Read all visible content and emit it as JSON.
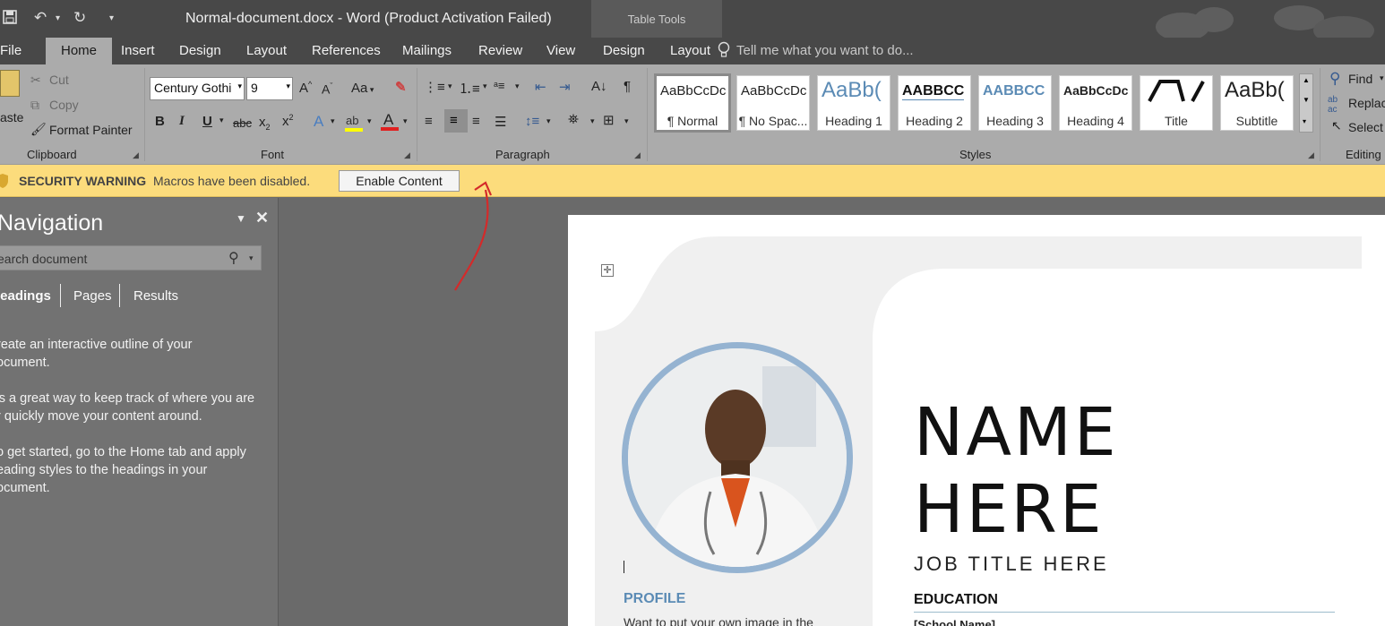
{
  "titlebar": {
    "doc_title": "Normal-document.docx - Word (Product Activation Failed)",
    "table_tools": "Table Tools"
  },
  "tabs": {
    "file": "File",
    "home": "Home",
    "insert": "Insert",
    "design": "Design",
    "layout": "Layout",
    "references": "References",
    "mailings": "Mailings",
    "review": "Review",
    "view": "View",
    "table_design": "Design",
    "table_layout": "Layout",
    "tell_me": "Tell me what you want to do..."
  },
  "clipboard": {
    "paste": "aste",
    "cut": "Cut",
    "copy": "Copy",
    "format_painter": "Format Painter",
    "label": "Clipboard"
  },
  "font": {
    "family": "Century Gothi",
    "size": "9",
    "change_case": "Aa",
    "label": "Font"
  },
  "paragraph": {
    "label": "Paragraph"
  },
  "styles": {
    "label": "Styles",
    "items": [
      {
        "sample": "AaBbCcDc",
        "name": "¶ Normal"
      },
      {
        "sample": "AaBbCcDc",
        "name": "¶ No Spac..."
      },
      {
        "sample": "AaBb(",
        "name": "Heading 1"
      },
      {
        "sample": "AABBCC",
        "name": "Heading 2"
      },
      {
        "sample": "AABBCC",
        "name": "Heading 3"
      },
      {
        "sample": "AaBbCcDc",
        "name": "Heading 4"
      },
      {
        "sample": "/\\ /",
        "name": "Title"
      },
      {
        "sample": "AaBb(",
        "name": "Subtitle"
      }
    ]
  },
  "editing": {
    "find": "Find",
    "replace": "Replac",
    "select": "Select",
    "label": "Editing"
  },
  "security": {
    "warning": "SECURITY WARNING",
    "message": "Macros have been disabled.",
    "enable": "Enable Content"
  },
  "navigation": {
    "title": "Navigation",
    "search_placeholder": "earch document",
    "tabs": [
      "leadings",
      "Pages",
      "Results"
    ],
    "paragraphs": [
      "reate an interactive outline of your\nocument.",
      "'s a great way to keep track of where you are\nr quickly move your content around.",
      "o get started, go to the Home tab and apply\neading styles to the headings in your\nocument."
    ]
  },
  "document": {
    "name_line1": "NAME",
    "name_line2": "HERE",
    "job_title": "JOB TITLE HERE",
    "education": "EDUCATION",
    "school": "[School Name]",
    "profile": "PROFILE",
    "profile_text": "Want to put your own image in the"
  },
  "colors": {
    "accent_blue": "#5b8bb5",
    "security_bar": "#fcdc7c",
    "ribbon": "#ababab",
    "annotation_arrow": "#d42a2a"
  }
}
